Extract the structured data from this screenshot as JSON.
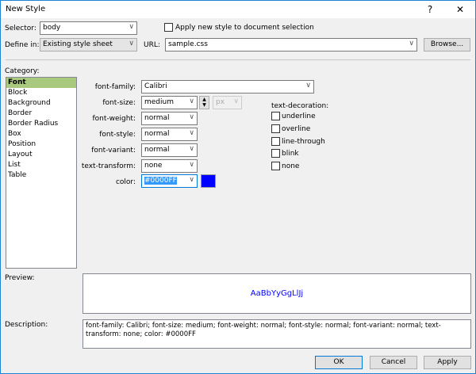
{
  "window": {
    "title": "New Style",
    "help": "?",
    "close": "✕"
  },
  "selector": {
    "label": "Selector:",
    "value": "body"
  },
  "apply_checkbox": {
    "label": "Apply new style to document selection",
    "checked": false
  },
  "define_in": {
    "label": "Define in:",
    "value": "Existing style sheet"
  },
  "url": {
    "label": "URL:",
    "value": "sample.css"
  },
  "browse_label": "Browse...",
  "category": {
    "label": "Category:",
    "items": [
      "Font",
      "Block",
      "Background",
      "Border",
      "Border Radius",
      "Box",
      "Position",
      "Layout",
      "List",
      "Table"
    ],
    "selected": "Font"
  },
  "font": {
    "family": {
      "label": "font-family:",
      "value": "Calibri"
    },
    "size": {
      "label": "font-size:",
      "value": "medium",
      "unit": "px"
    },
    "weight": {
      "label": "font-weight:",
      "value": "normal"
    },
    "style": {
      "label": "font-style:",
      "value": "normal"
    },
    "variant": {
      "label": "font-variant:",
      "value": "normal"
    },
    "transform": {
      "label": "text-transform:",
      "value": "none"
    },
    "color": {
      "label": "color:",
      "value": "#0000FF",
      "swatch": "#0000FF"
    }
  },
  "decoration": {
    "label": "text-decoration:",
    "options": [
      "underline",
      "overline",
      "line-through",
      "blink",
      "none"
    ]
  },
  "preview": {
    "label": "Preview:",
    "sample": "AaBbYyGgLlJj"
  },
  "description": {
    "label": "Description:",
    "text": "font-family: Calibri; font-size: medium; font-weight: normal; font-style: normal; font-variant: normal; text-transform: none; color: #0000FF"
  },
  "buttons": {
    "ok": "OK",
    "cancel": "Cancel",
    "apply": "Apply"
  }
}
